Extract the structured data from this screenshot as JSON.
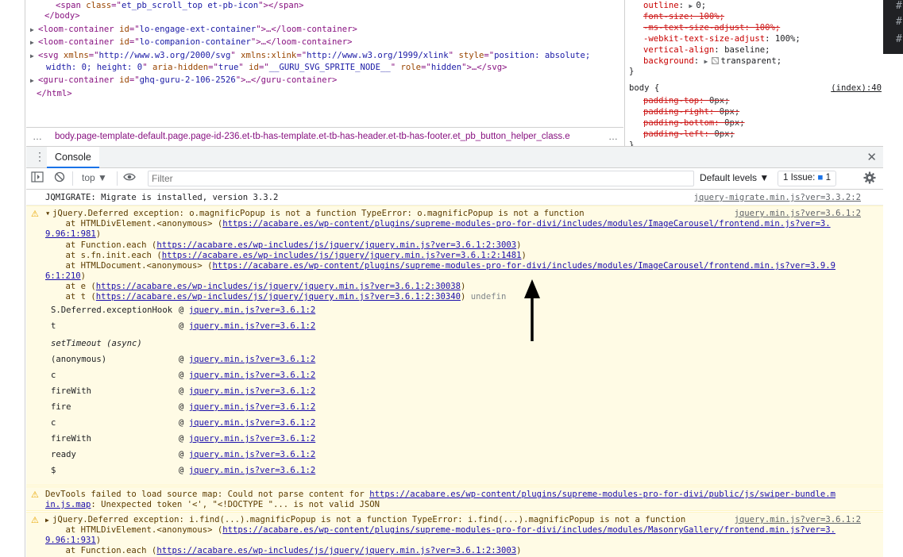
{
  "elements": {
    "lines": [
      {
        "indent": 70,
        "parts": [
          [
            "tag",
            "<span "
          ],
          [
            "attr-name",
            "class"
          ],
          [
            "tag",
            "=\""
          ],
          [
            "attr-val",
            "et_pb_scroll_top et-pb-icon"
          ],
          [
            "tag",
            "\"></span>"
          ]
        ]
      },
      {
        "indent": 56,
        "parts": [
          [
            "tag",
            "</body>"
          ]
        ]
      },
      {
        "indent": 48,
        "tri": true,
        "parts": [
          [
            "tag",
            "<loom-container "
          ],
          [
            "attr-name",
            "id"
          ],
          [
            "tag",
            "=\""
          ],
          [
            "attr-val",
            "lo-engage-ext-container"
          ],
          [
            "tag",
            "\">…</loom-container>"
          ]
        ]
      },
      {
        "indent": 48,
        "tri": true,
        "parts": [
          [
            "tag",
            "<loom-container "
          ],
          [
            "attr-name",
            "id"
          ],
          [
            "tag",
            "=\""
          ],
          [
            "attr-val",
            "lo-companion-container"
          ],
          [
            "tag",
            "\">…</loom-container>"
          ]
        ]
      },
      {
        "indent": 48,
        "tri": true,
        "parts": [
          [
            "tag",
            "<svg "
          ],
          [
            "attr-name",
            "xmlns"
          ],
          [
            "tag",
            "=\""
          ],
          [
            "attr-val",
            "http://www.w3.org/2000/svg"
          ],
          [
            "tag",
            "\" "
          ],
          [
            "attr-name",
            "xmlns:xlink"
          ],
          [
            "tag",
            "=\""
          ],
          [
            "attr-val",
            "http://www.w3.org/1999/xlink"
          ],
          [
            "tag",
            "\" "
          ],
          [
            "attr-name",
            "style"
          ],
          [
            "tag",
            "=\""
          ],
          [
            "attr-val",
            "position: absolute;"
          ]
        ]
      },
      {
        "indent": 58,
        "parts": [
          [
            "attr-val",
            "width: 0; height: 0"
          ],
          [
            "tag",
            "\" "
          ],
          [
            "attr-name",
            "aria-hidden"
          ],
          [
            "tag",
            "=\""
          ],
          [
            "attr-val",
            "true"
          ],
          [
            "tag",
            "\" "
          ],
          [
            "attr-name",
            "id"
          ],
          [
            "tag",
            "=\""
          ],
          [
            "attr-val",
            "__GURU_SVG_SPRITE_NODE__"
          ],
          [
            "tag",
            "\" "
          ],
          [
            "attr-name",
            "role"
          ],
          [
            "tag",
            "=\""
          ],
          [
            "attr-val",
            "hidden"
          ],
          [
            "tag",
            "\">…</svg>"
          ]
        ]
      },
      {
        "indent": 48,
        "tri": true,
        "parts": [
          [
            "tag",
            "<guru-container "
          ],
          [
            "attr-name",
            "id"
          ],
          [
            "tag",
            "=\""
          ],
          [
            "attr-val",
            "ghq-guru-2-106-2526"
          ],
          [
            "tag",
            "\">…</guru-container>"
          ]
        ]
      },
      {
        "indent": 46,
        "parts": [
          [
            "tag",
            "</html>"
          ]
        ]
      }
    ],
    "breadcrumb": "body.page-template-default.page.page-id-236.et-tb-has-template.et-tb-has-header.et-tb-has-footer.et_pb_button_helper_class.e",
    "breadcrumb_left_dots": "…",
    "breadcrumb_right_dots": "…"
  },
  "styles": {
    "lines": [
      {
        "kind": "prop",
        "name": "outline",
        "tri": true,
        "value": "0;"
      },
      {
        "kind": "strike",
        "text": "font-size: 100%;"
      },
      {
        "kind": "strike",
        "text": "-ms-text-size-adjust: 100%;"
      },
      {
        "kind": "prop",
        "name": "-webkit-text-size-adjust",
        "value": "100%;"
      },
      {
        "kind": "prop",
        "name": "vertical-align",
        "value": "baseline;"
      },
      {
        "kind": "prop",
        "name": "background",
        "tri": true,
        "swatch": true,
        "value": "transparent;"
      },
      {
        "kind": "brace",
        "text": "}"
      },
      {
        "kind": "selector",
        "text": "body {",
        "source": "(index):40"
      },
      {
        "kind": "strike-val",
        "name": "padding-top",
        "value": "0px;"
      },
      {
        "kind": "strike-val",
        "name": "padding-right",
        "value": "0px;"
      },
      {
        "kind": "strike-val",
        "name": "padding-bottom",
        "value": "0px;"
      },
      {
        "kind": "strike-val",
        "name": "padding-left",
        "value": "0px;"
      },
      {
        "kind": "brace",
        "text": "}"
      }
    ]
  },
  "dark_corner": {
    "glyphs": [
      "#",
      "#",
      "#"
    ]
  },
  "drawer": {
    "tab_label": "Console",
    "close_glyph": "✕",
    "menu_glyph": "⋮"
  },
  "toolbar": {
    "context": "top",
    "filter_placeholder": "Filter",
    "levels": "Default levels",
    "issues_label": "1 Issue:",
    "issues_count": "1"
  },
  "console": {
    "info_1": {
      "text": "JQMIGRATE: Migrate is installed, version 3.3.2",
      "source": "jquery-migrate.min.js?ver=3.3.2:2"
    },
    "warn_1": {
      "headline": "jQuery.Deferred exception: o.magnificPopup is not a function TypeError: o.magnificPopup is not a function",
      "source": "jquery.min.js?ver=3.6.1:2",
      "l2_prefix": "    at HTMLDivElement.<anonymous> (",
      "l2_link": "https://acabare.es/wp-content/plugins/supreme-modules-pro-for-divi/includes/modules/ImageCarousel/frontend.min.js?ver=3.",
      "l3_link": "9.96:1:981",
      "l3_suffix": ")",
      "l4_prefix": "    at Function.each (",
      "l4_link": "https://acabare.es/wp-includes/js/jquery/jquery.min.js?ver=3.6.1:2:3003",
      "l4_suffix": ")",
      "l5_prefix": "    at s.fn.init.each (",
      "l5_link": "https://acabare.es/wp-includes/js/jquery/jquery.min.js?ver=3.6.1:2:1481",
      "l5_suffix": ")",
      "l6_prefix": "    at HTMLDocument.<anonymous> (",
      "l6_link": "https://acabare.es/wp-content/plugins/supreme-modules-pro-for-divi/includes/modules/ImageCarousel/frontend.min.js?ver=3.9.9",
      "l7_link": "6:1:210",
      "l7_suffix": ")",
      "l8_prefix": "    at e (",
      "l8_link": "https://acabare.es/wp-includes/js/jquery/jquery.min.js?ver=3.6.1:2:30038",
      "l8_suffix": ")",
      "l9_prefix": "    at t (",
      "l9_link": "https://acabare.es/wp-includes/js/jquery/jquery.min.js?ver=3.6.1:2:30340",
      "l9_suffix": ") ",
      "l9_tail": "undefin",
      "stack": [
        {
          "fn": "S.Deferred.exceptionHook",
          "at": "@",
          "link": "jquery.min.js?ver=3.6.1:2"
        },
        {
          "fn": "t",
          "at": "@",
          "link": "jquery.min.js?ver=3.6.1:2"
        },
        {
          "fn": "setTimeout (async)",
          "async": true
        },
        {
          "fn": "(anonymous)",
          "at": "@",
          "link": "jquery.min.js?ver=3.6.1:2"
        },
        {
          "fn": "c",
          "at": "@",
          "link": "jquery.min.js?ver=3.6.1:2"
        },
        {
          "fn": "fireWith",
          "at": "@",
          "link": "jquery.min.js?ver=3.6.1:2"
        },
        {
          "fn": "fire",
          "at": "@",
          "link": "jquery.min.js?ver=3.6.1:2"
        },
        {
          "fn": "c",
          "at": "@",
          "link": "jquery.min.js?ver=3.6.1:2"
        },
        {
          "fn": "fireWith",
          "at": "@",
          "link": "jquery.min.js?ver=3.6.1:2"
        },
        {
          "fn": "ready",
          "at": "@",
          "link": "jquery.min.js?ver=3.6.1:2"
        },
        {
          "fn": "$",
          "at": "@",
          "link": "jquery.min.js?ver=3.6.1:2"
        }
      ]
    },
    "warn_2": {
      "prefix": "DevTools failed to load source map: Could not parse content for ",
      "link": "https://acabare.es/wp-content/plugins/supreme-modules-pro-for-divi/public/js/swiper-bundle.m",
      "l2_link": "in.js.map",
      "l2_suffix": ": Unexpected token '<', \"<!DOCTYPE \"... is not valid JSON"
    },
    "warn_3": {
      "headline": "jQuery.Deferred exception: i.find(...).magnificPopup is not a function TypeError: i.find(...).magnificPopup is not a function",
      "source": "jquery.min.js?ver=3.6.1:2",
      "l2_prefix": "    at HTMLDivElement.<anonymous> (",
      "l2_link": "https://acabare.es/wp-content/plugins/supreme-modules-pro-for-divi/includes/modules/MasonryGallery/frontend.min.js?ver=3.",
      "l3_link": "9.96:1:931",
      "l3_suffix": ")",
      "l4_prefix": "    at Function.each (",
      "l4_link": "https://acabare.es/wp-includes/js/jquery/jquery.min.js?ver=3.6.1:2:3003",
      "l4_suffix": ")"
    }
  },
  "colors": {
    "warning_bg": "#fffbe5",
    "link": "#1a0dab",
    "accent": "#1a73e8"
  }
}
